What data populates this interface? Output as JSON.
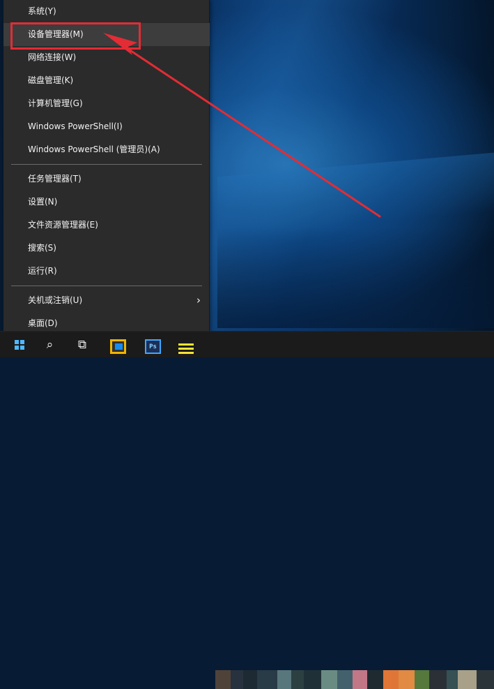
{
  "menu": {
    "items": [
      {
        "label": "系统(Y)"
      },
      {
        "label": "设备管理器(M)"
      },
      {
        "label": "网络连接(W)"
      },
      {
        "label": "磁盘管理(K)"
      },
      {
        "label": "计算机管理(G)"
      },
      {
        "label": "Windows PowerShell(I)"
      },
      {
        "label": "Windows PowerShell (管理员)(A)"
      },
      {
        "label": "任务管理器(T)"
      },
      {
        "label": "设置(N)"
      },
      {
        "label": "文件资源管理器(E)"
      },
      {
        "label": "搜索(S)"
      },
      {
        "label": "运行(R)"
      },
      {
        "label": "关机或注销(U)",
        "submenu_glyph": "›"
      },
      {
        "label": "桌面(D)"
      }
    ]
  },
  "taskbar": {
    "task_view_glyph": "⧉",
    "search_glyph": "⌕",
    "ps_label": "Ps",
    "accent_color": "#1d7fd8"
  },
  "annotations": {
    "highlight_color": "#e32c35"
  }
}
